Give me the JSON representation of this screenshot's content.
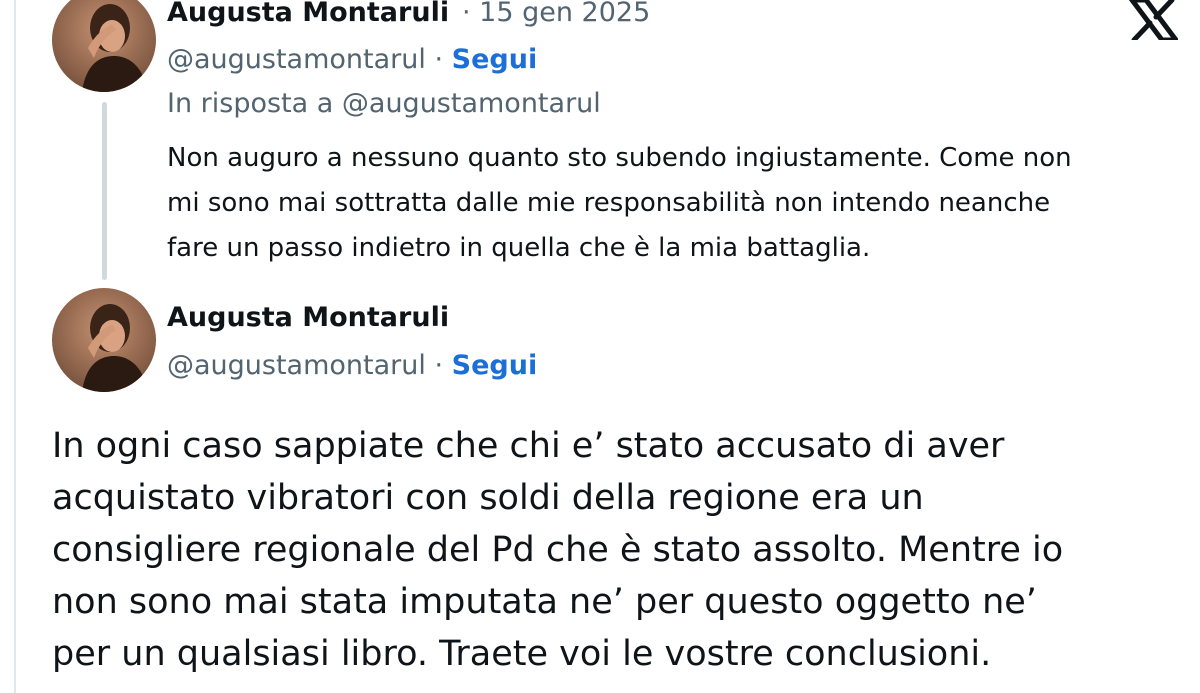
{
  "reply_tweet": {
    "author_name": "Augusta Montaruli",
    "separator_date": "· 15 gen 2025",
    "handle": "@augustamontarul",
    "dot": " · ",
    "follow_label": "Segui",
    "in_reply_to": "In risposta a @augustamontarul",
    "text": "Non auguro a nessuno quanto sto subendo ingiustamente. Come non\nmi sono mai sottratta dalle mie responsabilità non intendo neanche\nfare un passo indietro in quella che è la mia battaglia."
  },
  "main_tweet": {
    "author_name": "Augusta Montaruli",
    "handle": "@augustamontarul",
    "dot": " · ",
    "follow_label": "Segui",
    "text": "In ogni caso sappiate che chi e’ stato accusato di aver\nacquistato vibratori con soldi della regione era un\nconsigliere regionale del Pd che è stato assolto. Mentre io\nnon sono mai stata imputata ne’ per questo oggetto ne’\nper un qualsiasi libro. Traete voi le vostre conclusioni."
  },
  "icons": {
    "brand": "x-logo-icon",
    "avatar": "avatar"
  },
  "colors": {
    "text": "#0f1419",
    "secondary": "#536471",
    "link": "#1d6fd8",
    "thread_line": "#cfd9de"
  }
}
